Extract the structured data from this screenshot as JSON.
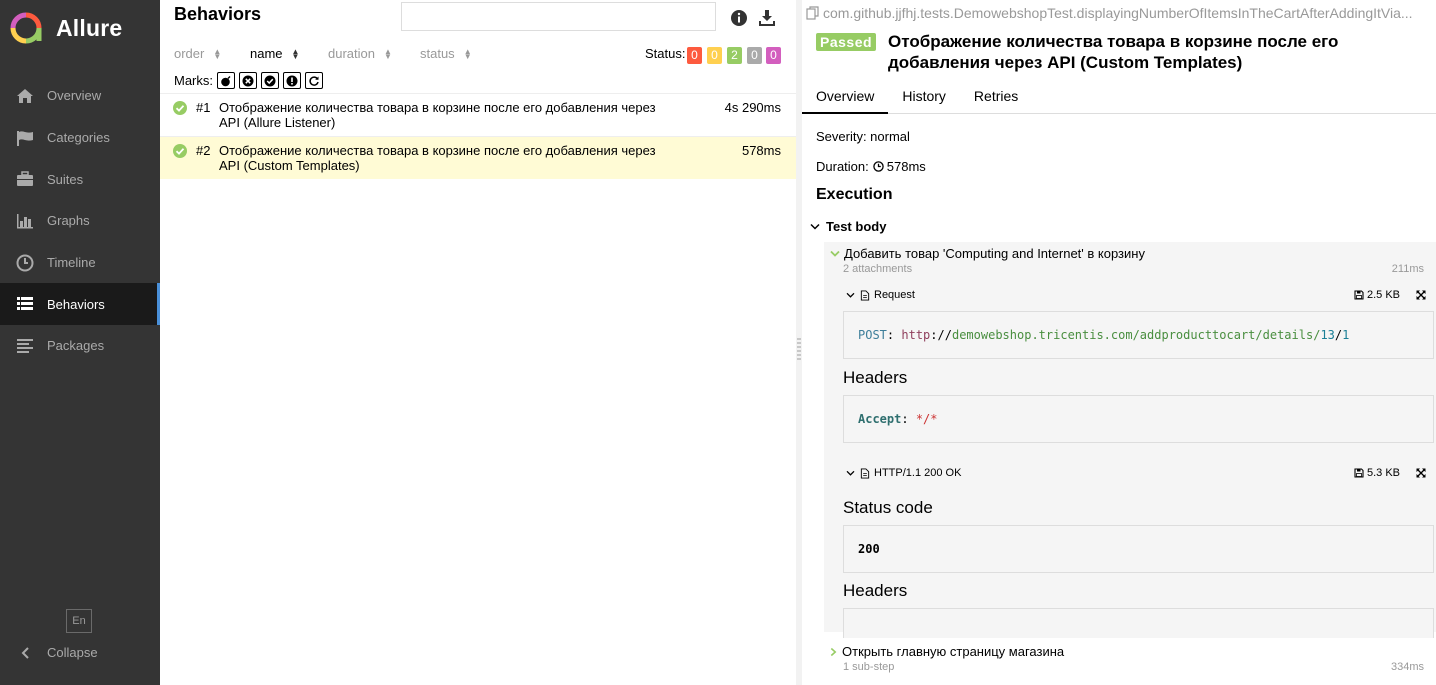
{
  "sidebar": {
    "brand": "Allure",
    "items": [
      {
        "label": "Overview",
        "icon": "home-icon"
      },
      {
        "label": "Categories",
        "icon": "flag-icon"
      },
      {
        "label": "Suites",
        "icon": "briefcase-icon"
      },
      {
        "label": "Graphs",
        "icon": "bar-chart-icon"
      },
      {
        "label": "Timeline",
        "icon": "clock-icon"
      },
      {
        "label": "Behaviors",
        "icon": "list-icon",
        "active": true
      },
      {
        "label": "Packages",
        "icon": "align-left-icon"
      }
    ],
    "language": "En",
    "collapse": "Collapse"
  },
  "tree": {
    "title": "Behaviors",
    "search_value": "",
    "sort": {
      "order": "order",
      "name": "name",
      "duration": "duration",
      "status": "status"
    },
    "status_label": "Status:",
    "status_counts": [
      {
        "value": "0",
        "color": "#fd5a3e"
      },
      {
        "value": "0",
        "color": "#ffd050"
      },
      {
        "value": "2",
        "color": "#97cc64"
      },
      {
        "value": "0",
        "color": "#aaaaaa"
      },
      {
        "value": "0",
        "color": "#d35ebe"
      }
    ],
    "marks_label": "Marks:",
    "marks": [
      "bomb-icon",
      "close-circle-icon",
      "check-circle-icon",
      "exclamation-icon",
      "refresh-icon"
    ],
    "rows": [
      {
        "num": "#1",
        "name": "Отображение количества товара в корзине после его добавления через API (Allure Listener)",
        "duration": "4s 290ms"
      },
      {
        "num": "#2",
        "name": "Отображение количества товара в корзине после его добавления через API (Custom Templates)",
        "duration": "578ms"
      }
    ]
  },
  "detail": {
    "path": "com.github.jjfhj.tests.DemowebshopTest.displayingNumberOfItemsInTheCartAfterAddingItVia...",
    "status": "Passed",
    "title": "Отображение количества товара в корзине после его добавления через API (Custom Templates)",
    "tabs": [
      "Overview",
      "History",
      "Retries"
    ],
    "severity": "Severity: normal",
    "duration_label": "Duration:",
    "duration": "578ms",
    "execution": "Execution",
    "test_body": "Test body",
    "step1": {
      "name": "Добавить товар 'Computing and Internet' в корзину",
      "sub": "2 attachments",
      "time": "211ms"
    },
    "request": {
      "label": "Request",
      "size": "2.5 KB",
      "method": "POST",
      "colon": ":",
      "scheme": "http",
      "sep": "://",
      "host_path": "demowebshop.tricentis.com/addproducttocart/details/",
      "n1": "13",
      "slash": "/",
      "n2": "1",
      "headers_title": "Headers",
      "header_key": "Accept",
      "header_colon": ":",
      "header_val": "*/*"
    },
    "response": {
      "label": "HTTP/1.1 200 OK",
      "size": "5.3 KB",
      "status_title": "Status code",
      "status_code": "200",
      "headers_title": "Headers"
    },
    "step2": {
      "name": "Открыть главную страницу магазина",
      "sub": "1 sub-step",
      "time": "334ms"
    }
  }
}
